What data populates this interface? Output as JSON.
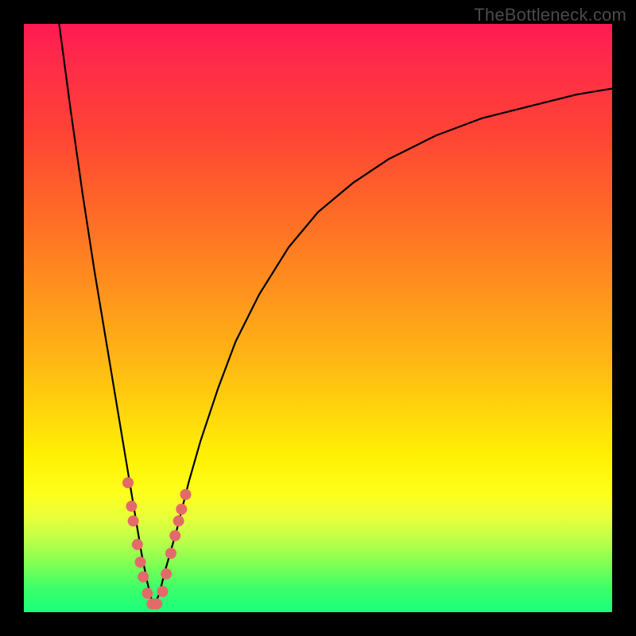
{
  "watermark": "TheBottleneck.com",
  "colors": {
    "frame": "#000000",
    "gradient_top": "#ff1a52",
    "gradient_mid": "#ffd60c",
    "gradient_bottom": "#18ff7d",
    "curve": "#000000",
    "dots": "#e46a6a"
  },
  "chart_data": {
    "type": "line",
    "title": "",
    "xlabel": "",
    "ylabel": "",
    "xlim": [
      0,
      100
    ],
    "ylim": [
      0,
      100
    ],
    "grid": false,
    "legend": false,
    "annotations": [
      "TheBottleneck.com"
    ],
    "note": "No numeric axes or tick labels are rendered in the image; x and y are normalized 0–100. A single V-shaped curve with minimum near x≈22, y≈0. Salmon dots cluster on both branches near the minimum (roughly y between 4 and 22).",
    "series": [
      {
        "name": "curve",
        "x": [
          6,
          8,
          10,
          12,
          14,
          16,
          18,
          19,
          20,
          21,
          22,
          23,
          24,
          26,
          28,
          30,
          33,
          36,
          40,
          45,
          50,
          56,
          62,
          70,
          78,
          86,
          94,
          100
        ],
        "y": [
          100,
          85,
          71,
          58,
          46,
          34,
          22,
          16,
          10,
          5,
          1,
          3,
          7,
          14,
          22,
          29,
          38,
          46,
          54,
          62,
          68,
          73,
          77,
          81,
          84,
          86,
          88,
          89
        ]
      }
    ],
    "dots": [
      {
        "x": 17.7,
        "y": 22
      },
      {
        "x": 18.3,
        "y": 18
      },
      {
        "x": 18.6,
        "y": 15.5
      },
      {
        "x": 19.3,
        "y": 11.5
      },
      {
        "x": 19.8,
        "y": 8.5
      },
      {
        "x": 20.3,
        "y": 6
      },
      {
        "x": 21.0,
        "y": 3.2
      },
      {
        "x": 21.8,
        "y": 1.4
      },
      {
        "x": 22.6,
        "y": 1.4
      },
      {
        "x": 23.6,
        "y": 3.5
      },
      {
        "x": 24.2,
        "y": 6.5
      },
      {
        "x": 25.0,
        "y": 10
      },
      {
        "x": 25.7,
        "y": 13
      },
      {
        "x": 26.3,
        "y": 15.5
      },
      {
        "x": 26.8,
        "y": 17.5
      },
      {
        "x": 27.5,
        "y": 20
      }
    ]
  }
}
